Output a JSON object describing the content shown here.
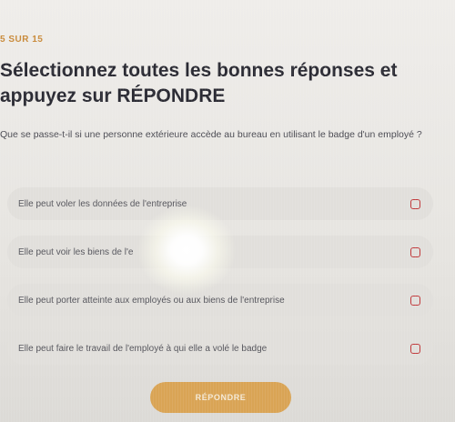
{
  "quiz": {
    "progress": "5 SUR 15",
    "headline": "Sélectionnez toutes les bonnes réponses et appuyez sur RÉPONDRE",
    "question": "Que se passe-t-il si une personne extérieure accède au bureau en utilisant le badge d'un employé ?",
    "options": [
      {
        "label": "Elle peut voler les données de l'entreprise",
        "checked": false
      },
      {
        "label": "Elle peut voir les biens de l'e",
        "checked": false
      },
      {
        "label": "Elle peut porter atteinte aux employés ou aux biens de l'entreprise",
        "checked": false
      },
      {
        "label": "Elle peut faire le travail de l'employé à qui elle a volé le badge",
        "checked": false
      }
    ],
    "submit_label": "RÉPONDRE"
  },
  "colors": {
    "accent": "#d9a455",
    "progress_text": "#c98a3a",
    "checkbox_border": "#c0393b",
    "heading_text": "#2a2a33"
  }
}
